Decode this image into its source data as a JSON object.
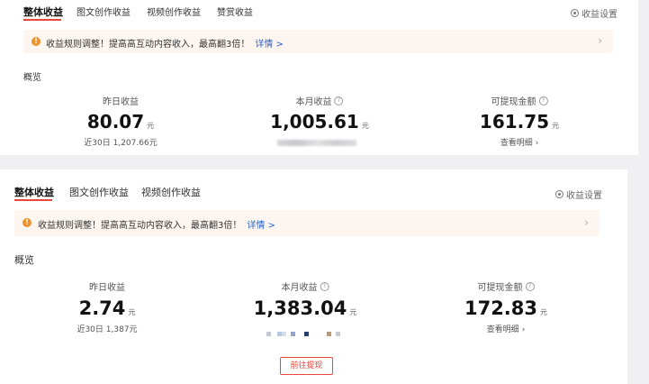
{
  "panel_a": {
    "tabs": [
      {
        "label": "整体收益",
        "active": true
      },
      {
        "label": "图文创作收益",
        "active": false
      },
      {
        "label": "视频创作收益",
        "active": false
      },
      {
        "label": "赞赏收益",
        "active": false
      }
    ],
    "settings_label": "收益设置",
    "notice": {
      "text": "收益规则调整！提高高互动内容收入，最高翻3倍！",
      "link": "详情 >"
    },
    "overview_title": "概览",
    "stats": [
      {
        "label": "昨日收益",
        "value": "80.07",
        "unit": "元",
        "sub": "近30日 1,207.66元"
      },
      {
        "label": "本月收益",
        "value": "1,005.61",
        "unit": "元"
      },
      {
        "label": "可提现金额",
        "value": "161.75",
        "unit": "元",
        "sub": "查看明细",
        "sub_arrow": "›"
      }
    ]
  },
  "panel_b": {
    "tabs": [
      {
        "label": "整体收益",
        "active": true
      },
      {
        "label": "图文创作收益",
        "active": false
      },
      {
        "label": "视频创作收益",
        "active": false
      }
    ],
    "settings_label": "收益设置",
    "notice": {
      "text": "收益规则调整！提高高互动内容收入，最高翻3倍！",
      "link": "详情 >"
    },
    "overview_title": "概览",
    "stats": [
      {
        "label": "昨日收益",
        "value": "2.74",
        "unit": "元",
        "sub": "近30日 1,387元"
      },
      {
        "label": "本月收益",
        "value": "1,383.04",
        "unit": "元"
      },
      {
        "label": "可提现金额",
        "value": "172.83",
        "unit": "元",
        "sub": "查看明细",
        "sub_arrow": "›"
      }
    ],
    "withdraw_button": "前往提现"
  },
  "colors": {
    "accent": "#e8473b",
    "warning": "#f0922e",
    "link": "#2a62c8",
    "notice_bg": "#fdf6f0"
  },
  "icons": {
    "settings": "gear-icon",
    "warning": "warning-icon",
    "help": "question-circle-icon",
    "chevron": "chevron-right-icon"
  }
}
